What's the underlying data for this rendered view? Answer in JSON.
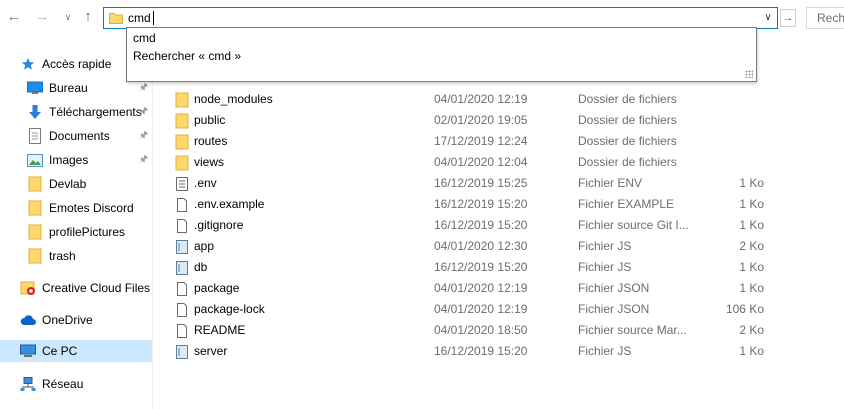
{
  "address": {
    "value": "cmd",
    "search_placeholder": "Rech"
  },
  "suggestions": [
    "cmd",
    "Rechercher « cmd »"
  ],
  "nav": {
    "quick_access": "Accès rapide",
    "items": [
      {
        "label": "Bureau",
        "icon": "desktop-icon",
        "pinned": true
      },
      {
        "label": "Téléchargements",
        "icon": "download-arrow-icon",
        "pinned": true
      },
      {
        "label": "Documents",
        "icon": "documents-icon",
        "pinned": true
      },
      {
        "label": "Images",
        "icon": "pictures-icon",
        "pinned": true
      },
      {
        "label": "Devlab",
        "icon": "folder-icon",
        "pinned": false
      },
      {
        "label": "Emotes Discord",
        "icon": "folder-icon",
        "pinned": false
      },
      {
        "label": "profilePictures",
        "icon": "folder-icon",
        "pinned": false
      },
      {
        "label": "trash",
        "icon": "folder-icon",
        "pinned": false
      }
    ],
    "creative_cloud": "Creative Cloud Files",
    "onedrive": "OneDrive",
    "this_pc": "Ce PC",
    "network": "Réseau"
  },
  "files": [
    {
      "name": "node_modules",
      "date": "04/01/2020 12:19",
      "type": "Dossier de fichiers",
      "size": "",
      "icon": "folder"
    },
    {
      "name": "public",
      "date": "02/01/2020 19:05",
      "type": "Dossier de fichiers",
      "size": "",
      "icon": "folder"
    },
    {
      "name": "routes",
      "date": "17/12/2019 12:24",
      "type": "Dossier de fichiers",
      "size": "",
      "icon": "folder"
    },
    {
      "name": "views",
      "date": "04/01/2020 12:04",
      "type": "Dossier de fichiers",
      "size": "",
      "icon": "folder"
    },
    {
      "name": ".env",
      "date": "16/12/2019 15:25",
      "type": "Fichier ENV",
      "size": "1 Ko",
      "icon": "text-file"
    },
    {
      "name": ".env.example",
      "date": "16/12/2019 15:20",
      "type": "Fichier EXAMPLE",
      "size": "1 Ko",
      "icon": "blank-file"
    },
    {
      "name": ".gitignore",
      "date": "16/12/2019 15:20",
      "type": "Fichier source Git I...",
      "size": "1 Ko",
      "icon": "blank-file"
    },
    {
      "name": "app",
      "date": "04/01/2020 12:30",
      "type": "Fichier JS",
      "size": "2 Ko",
      "icon": "js-file"
    },
    {
      "name": "db",
      "date": "16/12/2019 15:20",
      "type": "Fichier JS",
      "size": "1 Ko",
      "icon": "js-file"
    },
    {
      "name": "package",
      "date": "04/01/2020 12:19",
      "type": "Fichier JSON",
      "size": "1 Ko",
      "icon": "blank-file"
    },
    {
      "name": "package-lock",
      "date": "04/01/2020 12:19",
      "type": "Fichier JSON",
      "size": "106 Ko",
      "icon": "blank-file"
    },
    {
      "name": "README",
      "date": "04/01/2020 18:50",
      "type": "Fichier source Mar...",
      "size": "2 Ko",
      "icon": "blank-file"
    },
    {
      "name": "server",
      "date": "16/12/2019 15:20",
      "type": "Fichier JS",
      "size": "1 Ko",
      "icon": "js-file"
    }
  ],
  "colors": {
    "accent": "#0078d7",
    "folder": "#ffd86b",
    "selection": "#cce8ff"
  }
}
